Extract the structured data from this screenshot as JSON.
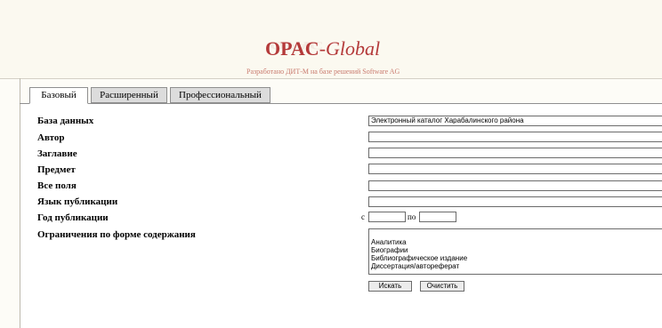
{
  "header": {
    "logo_main": "OPAC",
    "logo_sep": "-",
    "logo_suffix": "Global",
    "tagline": "Разработано ДИТ-М на базе решений Software AG"
  },
  "tabs": [
    {
      "label": "Базовый",
      "active": true
    },
    {
      "label": "Расширенный",
      "active": false
    },
    {
      "label": "Профессиональный",
      "active": false
    }
  ],
  "form": {
    "database_label": "База данных",
    "database_value": "Электронный каталог Харабалинского района",
    "author_label": "Автор",
    "author_value": "",
    "title_label": "Заглавие",
    "title_value": "",
    "subject_label": "Предмет",
    "subject_value": "",
    "all_fields_label": "Все поля",
    "all_fields_value": "",
    "language_label": "Язык публикации",
    "language_value": "",
    "year_label": "Год публикации",
    "year_from_label": "с",
    "year_from_value": "",
    "year_to_label": "по",
    "year_to_value": "",
    "content_form_label": "Ограничения по форме содержания",
    "content_form_options": [
      "Аналитика",
      "Биографии",
      "Библиографическое издание",
      "Диссертация/автореферат"
    ]
  },
  "buttons": {
    "search": "Искать",
    "clear": "Очистить"
  }
}
